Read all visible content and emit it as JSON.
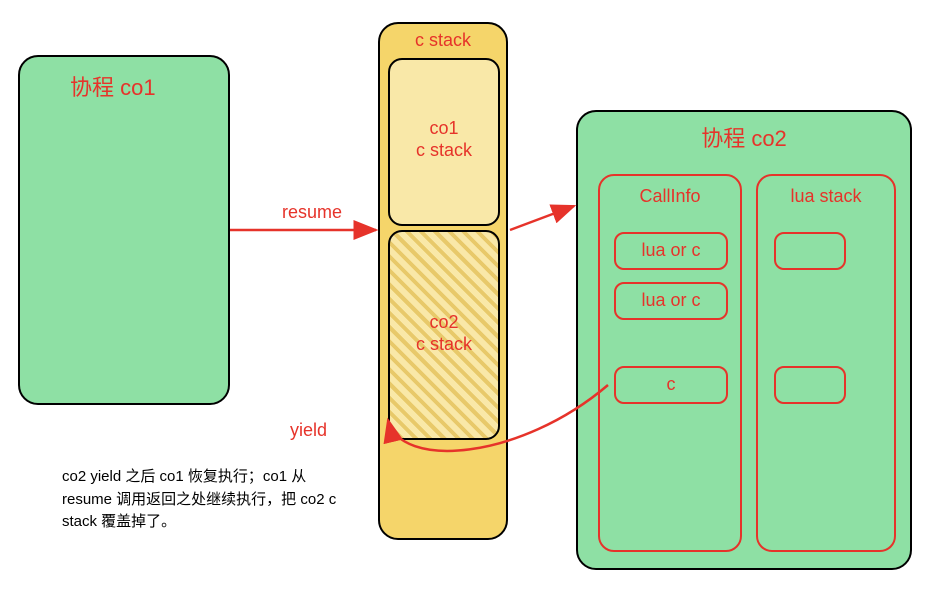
{
  "co1": {
    "title": "协程 co1"
  },
  "cstack": {
    "title": "c stack",
    "top_block": "co1\nc stack",
    "bottom_block": "co2\nc stack"
  },
  "co2": {
    "title": "协程 co2",
    "callinfo_label": "CallInfo",
    "luastack_label": "lua stack",
    "call_items": [
      "lua or c",
      "lua or c",
      "c"
    ]
  },
  "arrows": {
    "resume": "resume",
    "yield": "yield"
  },
  "description": "co2 yield 之后 co1 恢复执行；co1 从 resume 调用返回之处继续执行，把 co2 c stack 覆盖掉了。"
}
